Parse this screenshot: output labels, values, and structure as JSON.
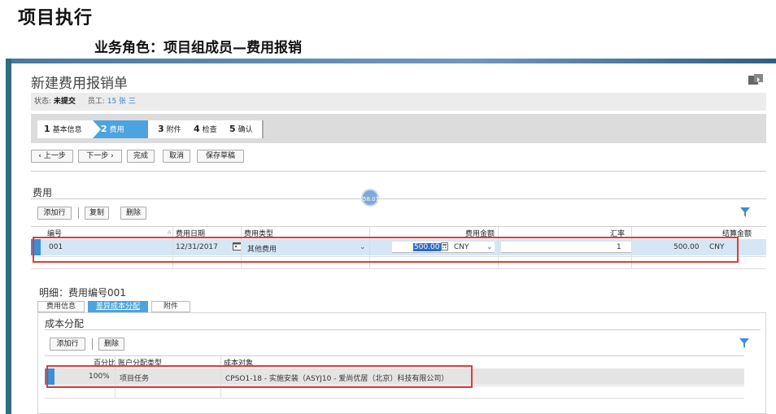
{
  "slide": {
    "title": "项目执行",
    "subtitle": "业务角色：项目组成员—费用报销"
  },
  "form": {
    "title": "新建费用报销单",
    "status_label": "状态:",
    "status_value": "未提交",
    "employee_label": "员工:",
    "employee_value": "15 张 三"
  },
  "steps": [
    {
      "num": "1",
      "label": "基本信息"
    },
    {
      "num": "2",
      "label": "费用"
    },
    {
      "num": "3",
      "label": "附件"
    },
    {
      "num": "4",
      "label": "检查"
    },
    {
      "num": "5",
      "label": "确认"
    }
  ],
  "toolbar": {
    "prev": "‹ 上一步",
    "next": "下一步 ›",
    "finish": "完成",
    "cancel": "取消",
    "save_draft": "保存草稿"
  },
  "expenses": {
    "section_title": "费用",
    "add_row": "添加行",
    "copy": "复制",
    "delete": "删除",
    "badge": "58.01",
    "columns": {
      "number": "编号",
      "date": "费用日期",
      "type": "费用类型",
      "amount": "费用金额",
      "rate": "汇率",
      "settle": "结算金额"
    },
    "rows": [
      {
        "number": "001",
        "date": "12/31/2017",
        "type": "其他费用",
        "amount": "500.00",
        "currency": "CNY",
        "rate": "1",
        "settle_amount": "500.00",
        "settle_currency": "CNY"
      }
    ]
  },
  "detail": {
    "title": "明细：费用编号001",
    "tabs": [
      "费用信息",
      "差异成本分配",
      "附件"
    ],
    "section_title": "成本分配",
    "add_row": "添加行",
    "delete": "删除",
    "columns": {
      "percent": "百分比",
      "assign_type": "账户分配类型",
      "cost_object": "成本对象"
    },
    "rows": [
      {
        "percent": "100%",
        "assign_type": "项目任务",
        "cost_object": "CPSO1-18 - 实施安装（ASYJ10 - 爱尚优居（北京）科技有限公司）"
      }
    ]
  },
  "colors": {
    "accent": "#4da3df",
    "selected_row": "#d5e6f5",
    "highlight_box": "#e03b3b",
    "frame": "#2f6d83"
  }
}
